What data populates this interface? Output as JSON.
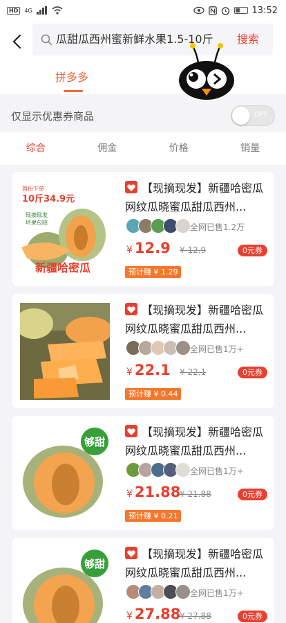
{
  "status_bar": {
    "left_badges": [
      "HD",
      "4G"
    ],
    "time": "13:52"
  },
  "header": {
    "search_value": "瓜甜瓜西州蜜新鲜水果1.5-10斤",
    "search_button": "搜索"
  },
  "tabs": {
    "active": "拼多多"
  },
  "coupon_filter": {
    "label": "仅显示优惠券商品",
    "toggle_text": "OFF",
    "toggle_on": false
  },
  "sort_tabs": [
    "综合",
    "佣金",
    "价格",
    "销量"
  ],
  "products": [
    {
      "title_line1": "【现摘现发】新疆哈密瓜",
      "title_line2": "网纹瓜晓蜜瓜甜瓜西州...",
      "sold": "全网已售1.2万",
      "currency": "¥",
      "price": "12.9",
      "old_price": "¥ 12.9",
      "coupon": "0元券",
      "earn": "预计赚 ¥ 1.29",
      "image": {
        "promo_line1": "首份下单",
        "promo_line2": "10斤34.9元",
        "promo_line3": "现摘现发",
        "promo_line4": "坏果包赔",
        "caption": "新疆哈密瓜"
      }
    },
    {
      "title_line1": "【现摘现发】新疆哈密瓜",
      "title_line2": "网纹瓜晓蜜瓜甜瓜西州...",
      "sold": "全网已售1万+",
      "currency": "¥",
      "price": "22.1",
      "old_price": "¥ 22.1",
      "coupon": "0元券",
      "earn": "预计赚 ¥ 0.44"
    },
    {
      "title_line1": "【现摘现发】新疆哈密瓜",
      "title_line2": "网纹瓜晓蜜瓜甜瓜西州...",
      "sold": "全网已售1万+",
      "currency": "¥",
      "price": "21.88",
      "old_price": "¥ 21.88",
      "coupon": "0元券",
      "earn": "预计赚 ¥ 0.21",
      "image": {
        "badge": "够甜"
      }
    },
    {
      "title_line1": "【现摘现发】新疆哈密瓜",
      "title_line2": "网纹瓜晓蜜瓜甜瓜西州...",
      "sold": "全网已售1万+",
      "currency": "¥",
      "price": "27.88",
      "old_price": "¥ 27.88",
      "coupon": "0元券",
      "image": {
        "badge": "够甜"
      }
    }
  ],
  "colors": {
    "accent": "#e8402f",
    "tab_orange": "#f2673a",
    "earn_orange": "#f6772b"
  }
}
